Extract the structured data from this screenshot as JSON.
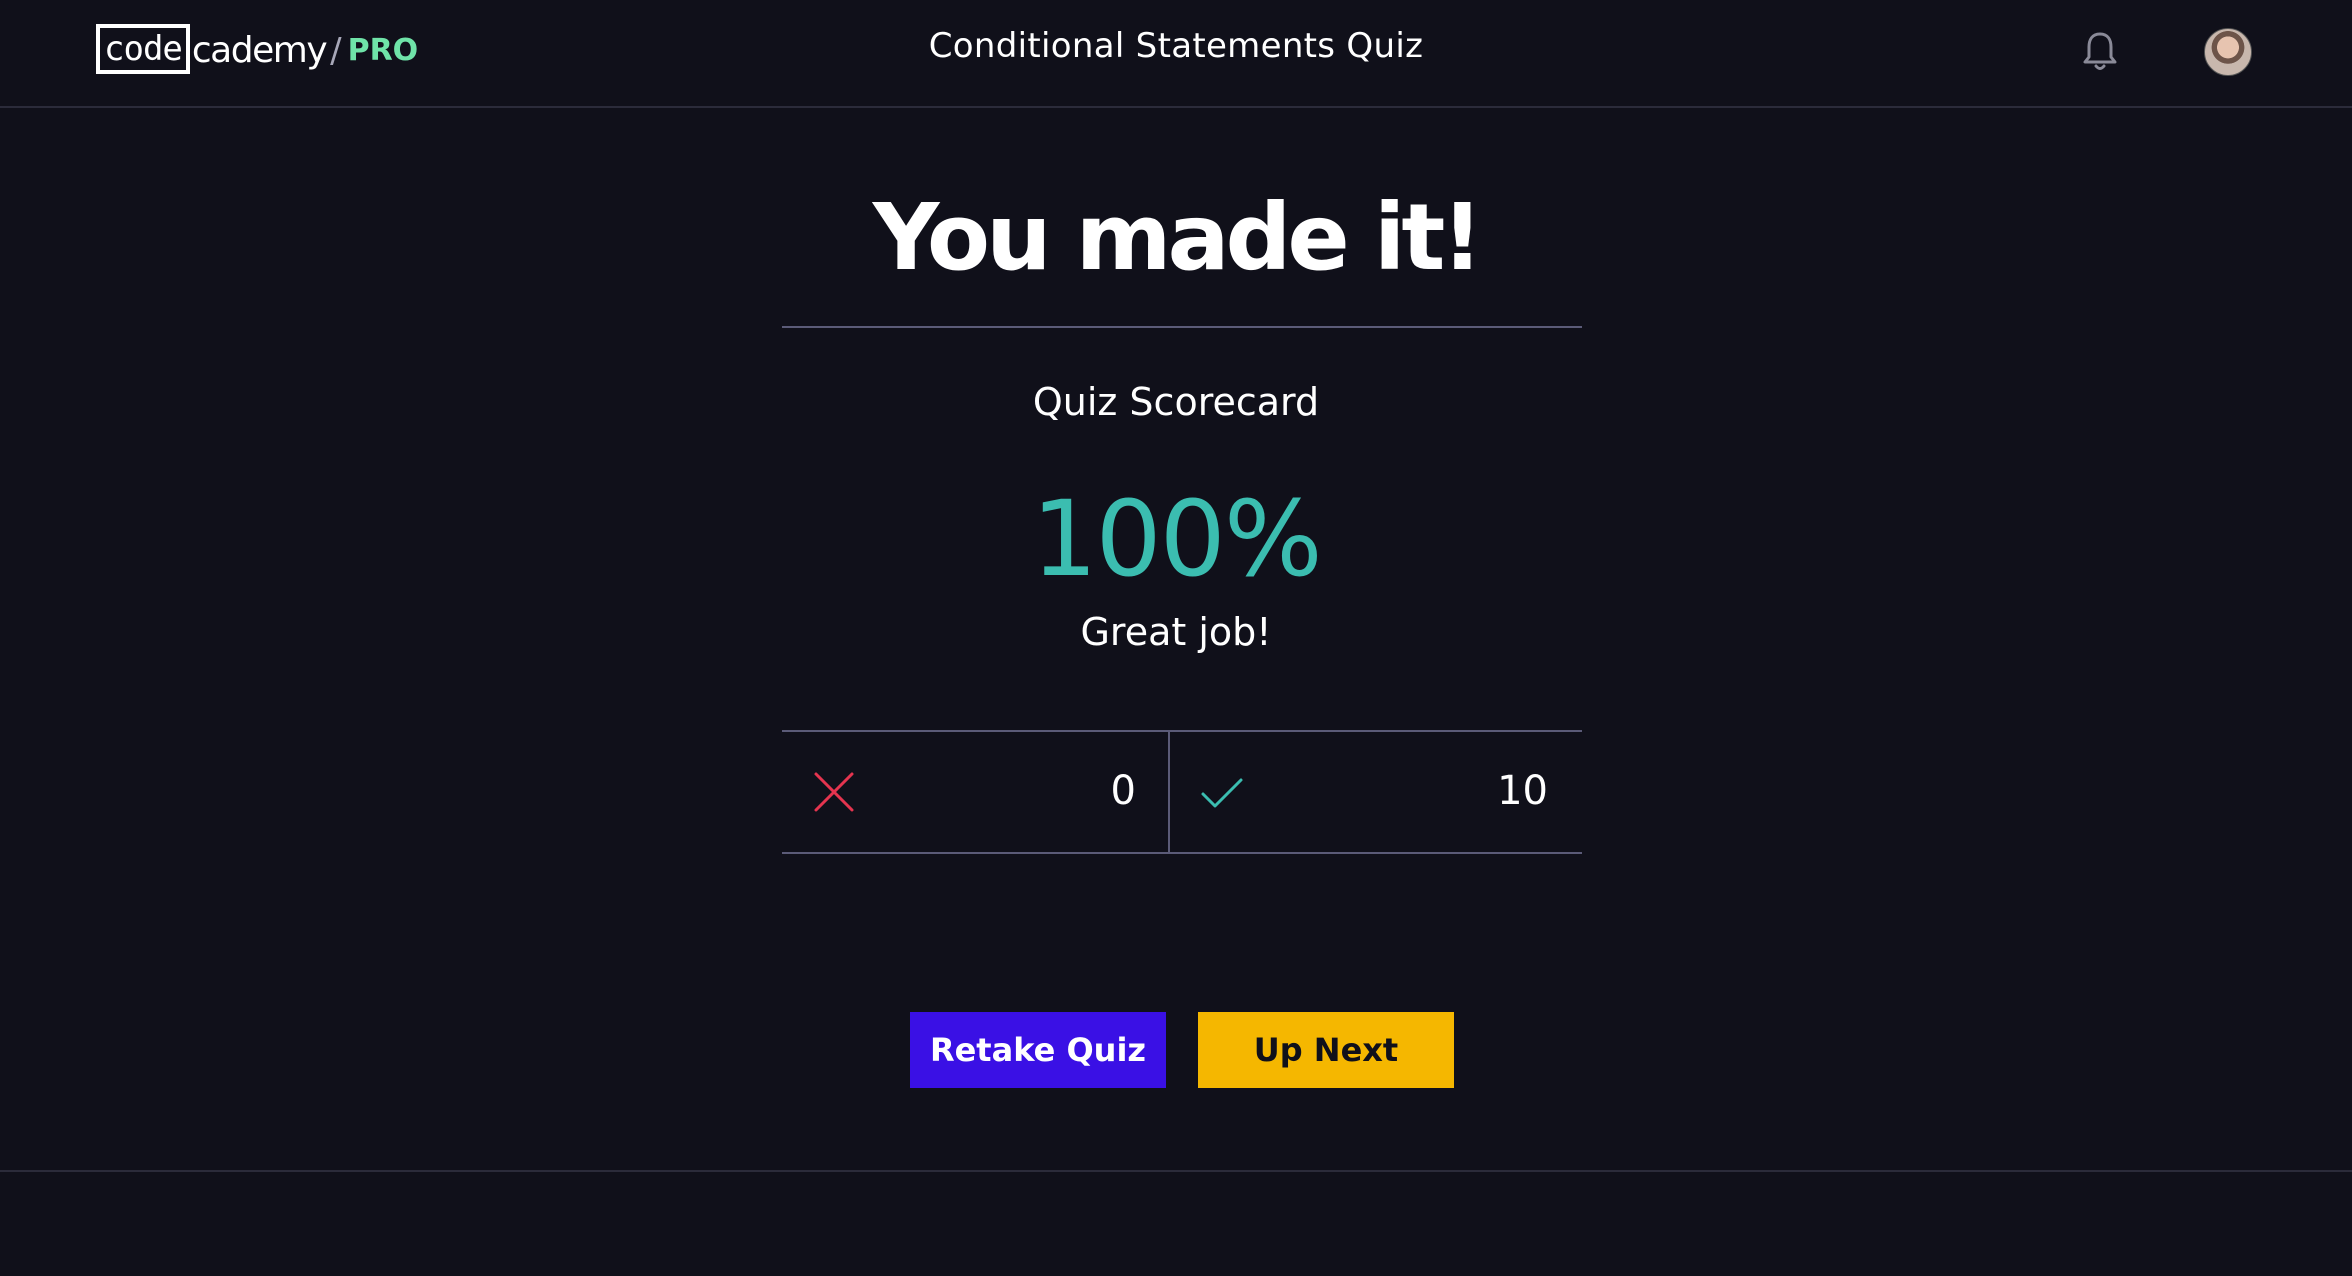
{
  "header": {
    "logo": {
      "code": "code",
      "cademy": "cademy",
      "slash": "/",
      "tier": "PRO"
    },
    "title": "Conditional Statements Quiz",
    "icons": {
      "notifications": "bell-icon",
      "profile": "avatar"
    }
  },
  "result": {
    "heading": "You made it!",
    "card_title": "Quiz Scorecard",
    "score": "100%",
    "message": "Great job!"
  },
  "tally": {
    "incorrect": {
      "icon": "x-icon",
      "count": "0",
      "color": "#e5344f"
    },
    "correct": {
      "icon": "check-icon",
      "count": "10",
      "color": "#3bbdb0"
    }
  },
  "actions": {
    "retake_label": "Retake Quiz",
    "next_label": "Up Next"
  },
  "colors": {
    "background": "#10101a",
    "accent_teal": "#3bbdb0",
    "retake_button": "#3a10e5",
    "next_button": "#f5b700",
    "pro": "#6fe3a8"
  }
}
